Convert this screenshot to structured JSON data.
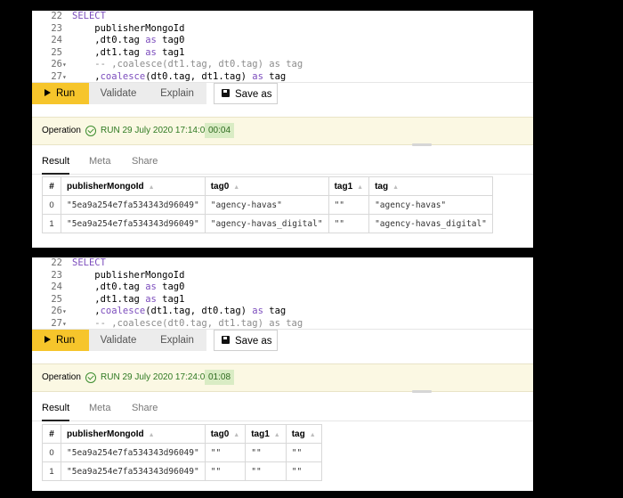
{
  "panels": [
    {
      "code": [
        {
          "ln": "22",
          "fold": "",
          "segs": [
            {
              "t": "SELECT",
              "c": "kw"
            }
          ]
        },
        {
          "ln": "23",
          "fold": "",
          "segs": [
            {
              "t": "    publisherMongoId",
              "c": ""
            }
          ]
        },
        {
          "ln": "24",
          "fold": "",
          "segs": [
            {
              "t": "    ,dt0.tag ",
              "c": ""
            },
            {
              "t": "as",
              "c": "kw"
            },
            {
              "t": " tag0",
              "c": ""
            }
          ]
        },
        {
          "ln": "25",
          "fold": "",
          "segs": [
            {
              "t": "    ,dt1.tag ",
              "c": ""
            },
            {
              "t": "as",
              "c": "kw"
            },
            {
              "t": " tag1",
              "c": ""
            }
          ]
        },
        {
          "ln": "26",
          "fold": "▾",
          "segs": [
            {
              "t": "    -- ,coalesce(dt1.tag, dt0.tag) as tag",
              "c": "cm"
            }
          ]
        },
        {
          "ln": "27",
          "fold": "▾",
          "segs": [
            {
              "t": "    ,",
              "c": ""
            },
            {
              "t": "coalesce",
              "c": "kw"
            },
            {
              "t": "(dt0.tag, dt1.tag) ",
              "c": ""
            },
            {
              "t": "as",
              "c": "kw"
            },
            {
              "t": " tag",
              "c": ""
            }
          ]
        }
      ],
      "toolbar": {
        "run": "Run",
        "validate": "Validate",
        "explain": "Explain",
        "save": "Save as"
      },
      "status": {
        "label": "Operation",
        "text": "RUN  29 July 2020 17:14:06",
        "elapsed": "00:04"
      },
      "tabs": {
        "result": "Result",
        "meta": "Meta",
        "share": "Share"
      },
      "columns": [
        "#",
        "publisherMongoId",
        "tag0",
        "tag1",
        "tag"
      ],
      "rows": [
        [
          "0",
          "\"5ea9a254e7fa534343d96049\"",
          "\"agency-havas\"",
          "\"\"",
          "\"agency-havas\""
        ],
        [
          "1",
          "\"5ea9a254e7fa534343d96049\"",
          "\"agency-havas_digital\"",
          "\"\"",
          "\"agency-havas_digital\""
        ]
      ]
    },
    {
      "code": [
        {
          "ln": "22",
          "fold": "",
          "segs": [
            {
              "t": "SELECT",
              "c": "kw"
            }
          ]
        },
        {
          "ln": "23",
          "fold": "",
          "segs": [
            {
              "t": "    publisherMongoId",
              "c": ""
            }
          ]
        },
        {
          "ln": "24",
          "fold": "",
          "segs": [
            {
              "t": "    ,dt0.tag ",
              "c": ""
            },
            {
              "t": "as",
              "c": "kw"
            },
            {
              "t": " tag0",
              "c": ""
            }
          ]
        },
        {
          "ln": "25",
          "fold": "",
          "segs": [
            {
              "t": "    ,dt1.tag ",
              "c": ""
            },
            {
              "t": "as",
              "c": "kw"
            },
            {
              "t": " tag1",
              "c": ""
            }
          ]
        },
        {
          "ln": "26",
          "fold": "▾",
          "segs": [
            {
              "t": "    ,",
              "c": ""
            },
            {
              "t": "coalesce",
              "c": "kw"
            },
            {
              "t": "(dt1.tag, dt0.tag) ",
              "c": ""
            },
            {
              "t": "as",
              "c": "kw"
            },
            {
              "t": " tag",
              "c": ""
            }
          ]
        },
        {
          "ln": "27",
          "fold": "▾",
          "segs": [
            {
              "t": "    -- ,coalesce(dt0.tag, dt1.tag) as tag",
              "c": "cm"
            }
          ]
        }
      ],
      "toolbar": {
        "run": "Run",
        "validate": "Validate",
        "explain": "Explain",
        "save": "Save as"
      },
      "status": {
        "label": "Operation",
        "text": "RUN  29 July 2020 17:24:01",
        "elapsed": "01:08"
      },
      "tabs": {
        "result": "Result",
        "meta": "Meta",
        "share": "Share"
      },
      "columns": [
        "#",
        "publisherMongoId",
        "tag0",
        "tag1",
        "tag"
      ],
      "rows": [
        [
          "0",
          "\"5ea9a254e7fa534343d96049\"",
          "\"\"",
          "\"\"",
          "\"\""
        ],
        [
          "1",
          "\"5ea9a254e7fa534343d96049\"",
          "\"\"",
          "\"\"",
          "\"\""
        ]
      ]
    }
  ],
  "colors": {
    "run_button": "#f6c52b",
    "status_bg": "#fbf8e3",
    "status_green": "#2f7a22",
    "keyword": "#7c4dbd",
    "comment": "#8c8c8c"
  }
}
